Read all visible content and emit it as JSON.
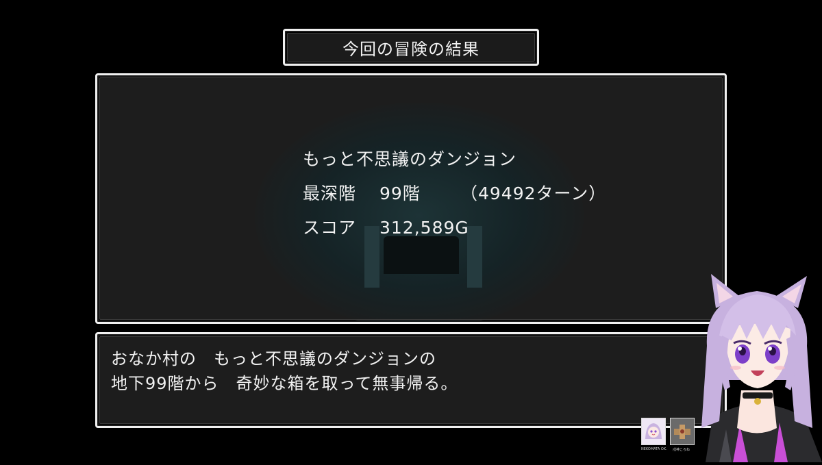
{
  "title_box": {
    "title": "今回の冒険の結果"
  },
  "result": {
    "dungeon_name": "もっと不思議のダンジョン",
    "deepest_label": "最深階",
    "deepest_value": "99階",
    "turns": "（49492ターン）",
    "score_label": "スコア",
    "score_value": "312,589G"
  },
  "message": {
    "line1": "おなか村の　もっと不思議のダンジョンの",
    "line2": "地下99階から　奇妙な箱を取って無事帰る。"
  },
  "stream_overlay": {
    "label1": "NEKOMATA OK.",
    "label2": "戌神ころね"
  },
  "colors": {
    "background": "#000000",
    "panel": "#1d1d1d",
    "border": "#f0f0f0",
    "text": "#f2f2f2",
    "avatar_hair": "#c9b3e0",
    "avatar_accent": "#c94fd6"
  },
  "icons": {
    "avatar": "catgirl-vtuber-avatar",
    "thumb1": "avatar-thumbnail-icon",
    "thumb2": "collaborator-thumbnail-icon"
  }
}
